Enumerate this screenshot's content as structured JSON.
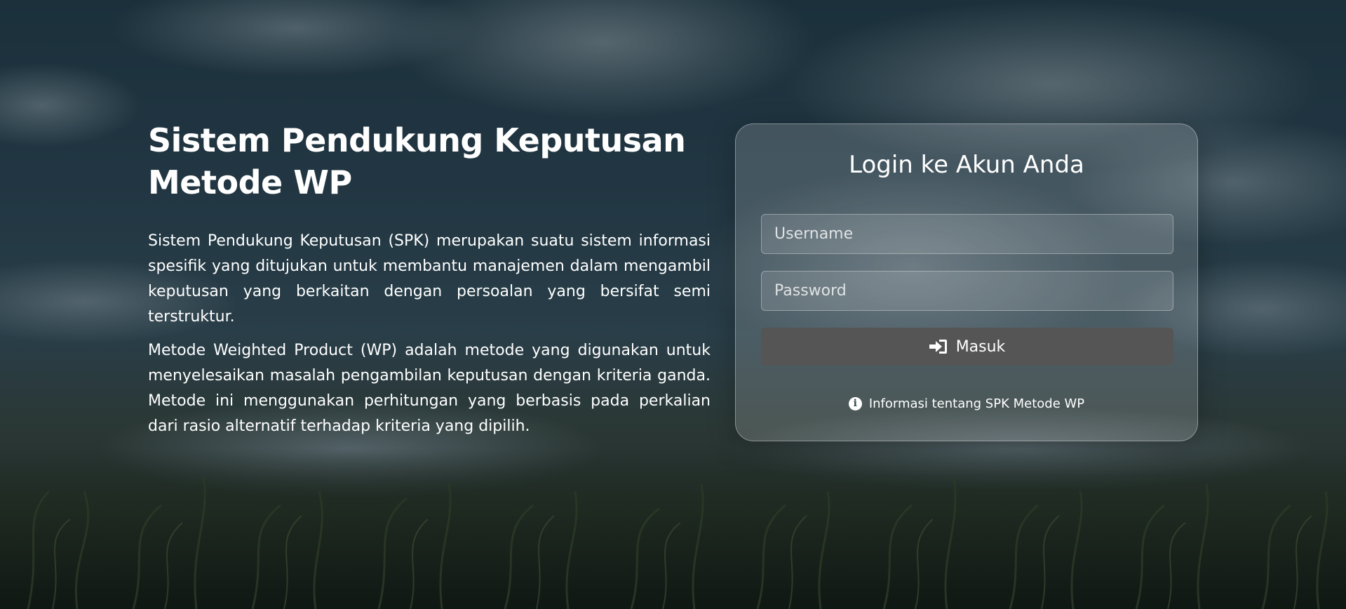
{
  "hero": {
    "title_line1": "Sistem Pendukung Keputusan",
    "title_line2": "Metode WP",
    "paragraph1": "Sistem Pendukung Keputusan (SPK) merupakan suatu sistem informasi spesifik yang ditujukan untuk membantu manajemen dalam mengambil keputusan yang berkaitan dengan persoalan yang bersifat semi terstruktur.",
    "paragraph2": "Metode Weighted Product (WP) adalah metode yang digunakan untuk menyelesaikan masalah pengambilan keputusan dengan kriteria ganda. Metode ini menggunakan perhitungan yang berbasis pada perkalian dari rasio alternatif terhadap kriteria yang dipilih."
  },
  "login": {
    "title": "Login ke Akun Anda",
    "username_placeholder": "Username",
    "password_placeholder": "Password",
    "submit_label": "Masuk",
    "submit_icon": "sign-in-icon",
    "info_label": "Informasi tentang SPK Metode WP",
    "info_icon": "info-circle-icon"
  },
  "colors": {
    "button_bg": "#555555",
    "text": "#ffffff"
  }
}
